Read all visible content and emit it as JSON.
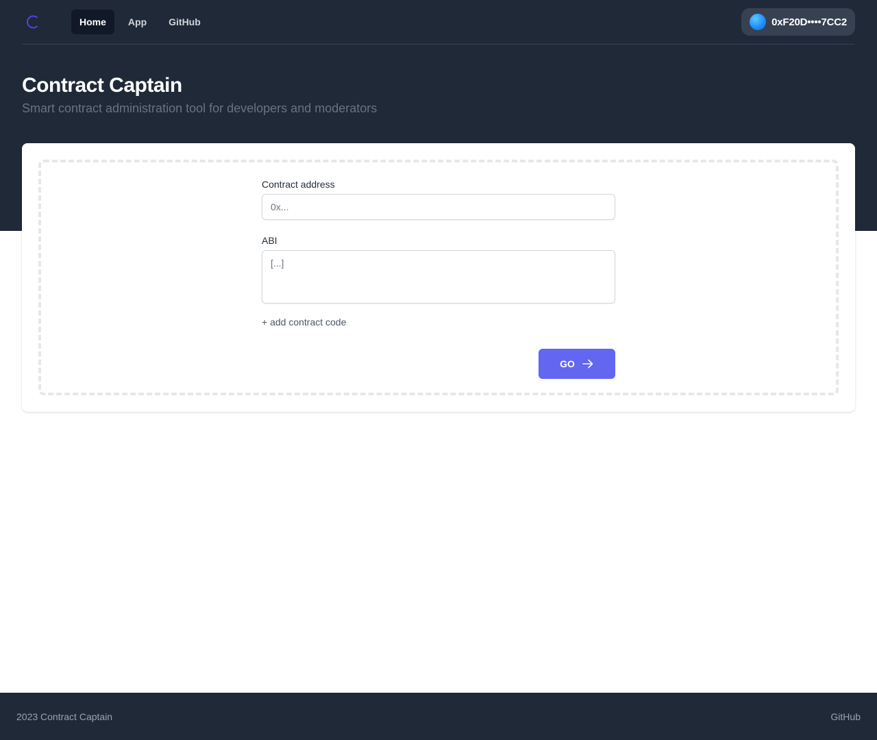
{
  "nav": {
    "logo_icon": "c-logo-icon",
    "links": [
      {
        "label": "Home",
        "active": true
      },
      {
        "label": "App",
        "active": false
      },
      {
        "label": "GitHub",
        "active": false
      }
    ],
    "wallet": {
      "address": "0xF20D••••7CC2",
      "avatar_icon": "wallet-avatar-icon"
    }
  },
  "header": {
    "title": "Contract Captain",
    "subtitle": "Smart contract administration tool for developers and moderators"
  },
  "form": {
    "address_label": "Contract address",
    "address_placeholder": "0x...",
    "abi_label": "ABI",
    "abi_placeholder": "[...]",
    "add_code_label": "+ add contract code",
    "go_label": "GO",
    "go_icon": "arrow-right-icon"
  },
  "footer": {
    "copyright": "2023 Contract Captain",
    "link": "GitHub"
  },
  "colors": {
    "header_bg": "#1f2937",
    "accent": "#6366f1",
    "logo": "#4f46e5"
  }
}
